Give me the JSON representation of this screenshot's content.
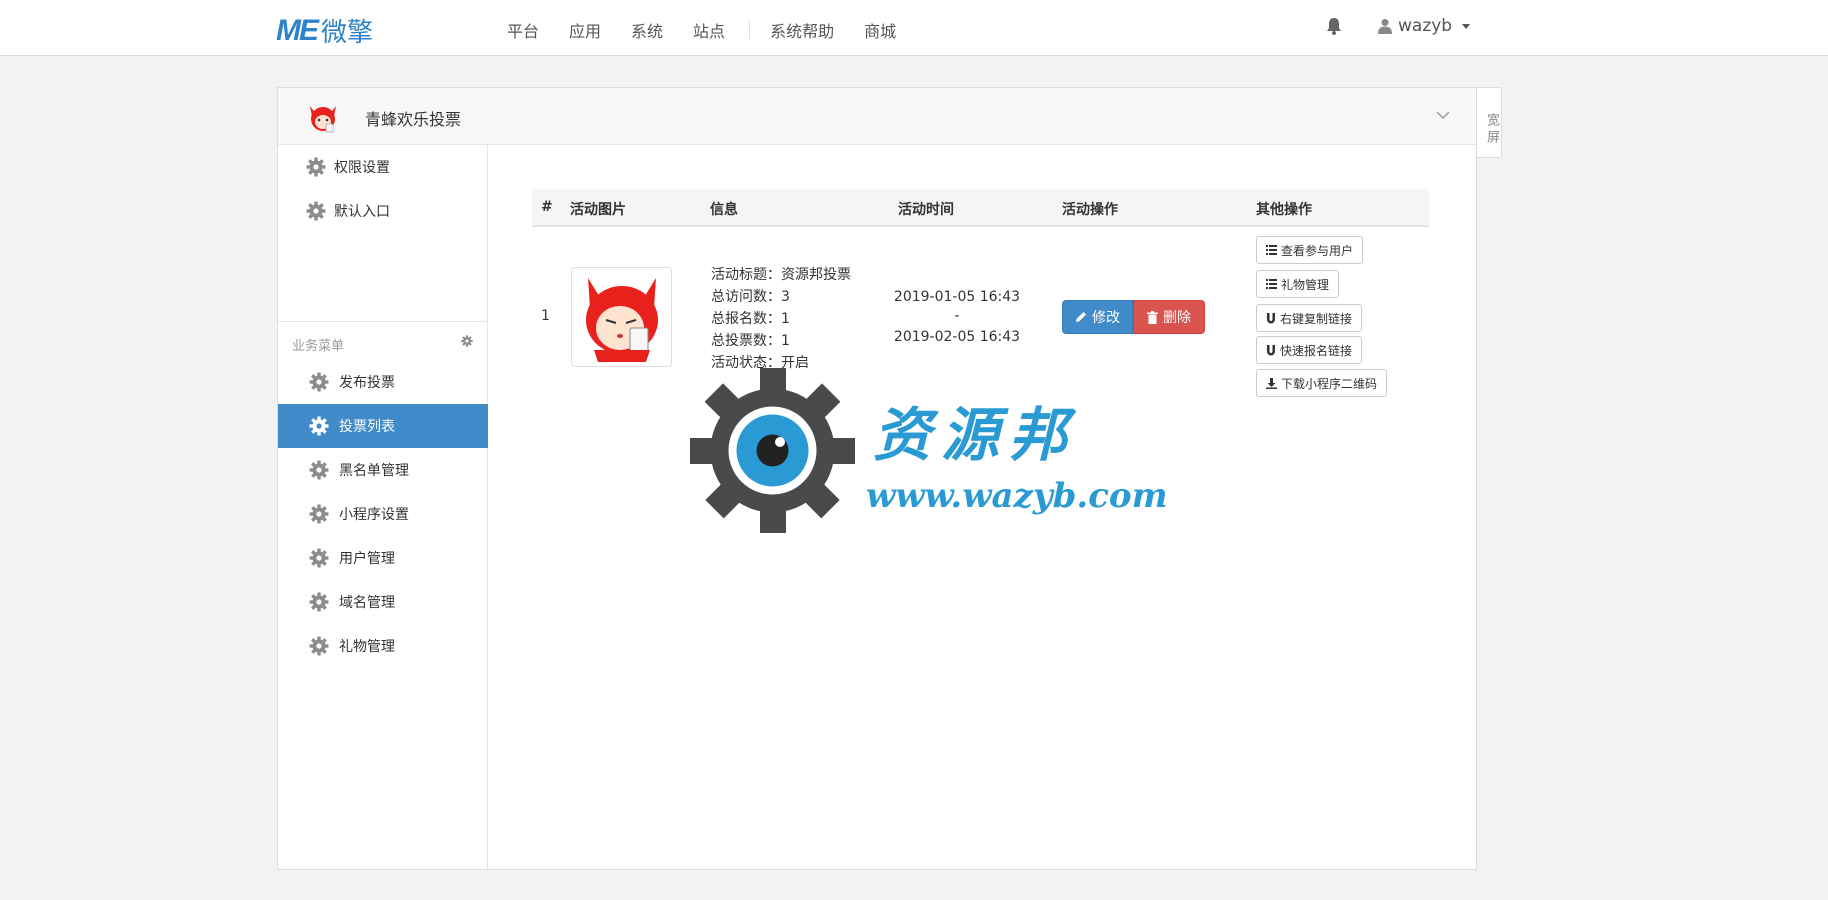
{
  "header": {
    "logo_mark": "ME",
    "logo_text": "微擎",
    "nav": [
      "平台",
      "应用",
      "系统",
      "站点",
      "系统帮助",
      "商城"
    ],
    "username": "wazyb"
  },
  "module": {
    "title": "青蜂欢乐投票",
    "wide_tab": "宽屏"
  },
  "sidebar": {
    "top_items": [
      {
        "label": "权限设置"
      },
      {
        "label": "默认入口"
      }
    ],
    "group_label": "业务菜单",
    "items": [
      {
        "label": "发布投票",
        "active": false
      },
      {
        "label": "投票列表",
        "active": true
      },
      {
        "label": "黑名单管理",
        "active": false
      },
      {
        "label": "小程序设置",
        "active": false
      },
      {
        "label": "用户管理",
        "active": false
      },
      {
        "label": "域名管理",
        "active": false
      },
      {
        "label": "礼物管理",
        "active": false
      }
    ]
  },
  "table": {
    "headers": [
      "#",
      "活动图片",
      "信息",
      "活动时间",
      "活动操作",
      "其他操作"
    ],
    "rows": [
      {
        "index": "1",
        "info": [
          "活动标题：资源邦投票",
          "总访问数：3",
          "总报名数：1",
          "总投票数：1",
          "活动状态：开启"
        ],
        "time_start": "2019-01-05 16:43",
        "time_sep": "-",
        "time_end": "2019-02-05 16:43",
        "edit_label": "修改",
        "delete_label": "删除",
        "other_actions": [
          "查看参与用户",
          "礼物管理",
          "右键复制链接",
          "快速报名链接",
          "下载小程序二维码"
        ]
      }
    ]
  },
  "watermark": {
    "cn": "资源邦",
    "url": "www.wazyb.com"
  },
  "colors": {
    "brand": "#2e83c8",
    "primary": "#428bca",
    "danger": "#d9534f"
  }
}
